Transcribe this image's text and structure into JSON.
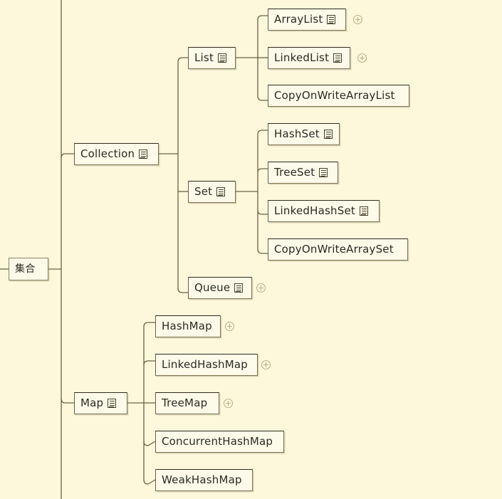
{
  "diagram": {
    "title": "集合",
    "type": "mindmap",
    "background_color": "#fdf8dc",
    "node_fill_color": "#fdfaea",
    "node_border_color": "#7d7351",
    "edge_color": "#6b6244",
    "expand_icon_color": "#b8ad85",
    "icons": {
      "note": "note-icon",
      "expand": "plus-circle-icon"
    }
  },
  "nodes": {
    "root": {
      "label": "集合",
      "has_note": false,
      "has_expand": false
    },
    "collection": {
      "label": "Collection",
      "has_note": true,
      "has_expand": false
    },
    "list": {
      "label": "List",
      "has_note": true,
      "has_expand": false
    },
    "arraylist": {
      "label": "ArrayList",
      "has_note": true,
      "has_expand": true
    },
    "linkedlist": {
      "label": "LinkedList",
      "has_note": true,
      "has_expand": true
    },
    "copyonwritearraylist": {
      "label": "CopyOnWriteArrayList",
      "has_note": false,
      "has_expand": false
    },
    "set": {
      "label": "Set",
      "has_note": true,
      "has_expand": false
    },
    "hashset": {
      "label": "HashSet",
      "has_note": true,
      "has_expand": false
    },
    "treeset": {
      "label": "TreeSet",
      "has_note": true,
      "has_expand": false
    },
    "linkedhashset": {
      "label": "LinkedHashSet",
      "has_note": true,
      "has_expand": false
    },
    "copyonwritearrayset": {
      "label": "CopyOnWriteArraySet",
      "has_note": false,
      "has_expand": false
    },
    "queue": {
      "label": "Queue",
      "has_note": true,
      "has_expand": true
    },
    "map": {
      "label": "Map",
      "has_note": true,
      "has_expand": false
    },
    "hashmap": {
      "label": "HashMap",
      "has_note": false,
      "has_expand": true
    },
    "linkedhashmap": {
      "label": "LinkedHashMap",
      "has_note": false,
      "has_expand": true
    },
    "treemap": {
      "label": "TreeMap",
      "has_note": false,
      "has_expand": true
    },
    "concurrenthashmap": {
      "label": "ConcurrentHashMap",
      "has_note": false,
      "has_expand": false
    },
    "weakhashmap": {
      "label": "WeakHashMap",
      "has_note": false,
      "has_expand": false
    }
  },
  "hierarchy": {
    "集合": {
      "Collection": {
        "List": [
          "ArrayList",
          "LinkedList",
          "CopyOnWriteArrayList"
        ],
        "Set": [
          "HashSet",
          "TreeSet",
          "LinkedHashSet",
          "CopyOnWriteArraySet"
        ],
        "Queue": []
      },
      "Map": [
        "HashMap",
        "LinkedHashMap",
        "TreeMap",
        "ConcurrentHashMap",
        "WeakHashMap"
      ]
    }
  }
}
